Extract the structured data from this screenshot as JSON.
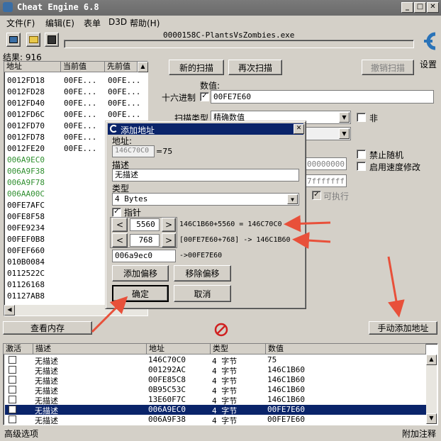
{
  "window": {
    "title": "Cheat Engine 6.8",
    "process": "0000158C-PlantsVsZombies.exe"
  },
  "menu": [
    "文件(F)",
    "编辑(E)",
    "表单",
    "D3D",
    "帮助(H)"
  ],
  "results": {
    "label": "结果: 916"
  },
  "list": {
    "headers": [
      "地址",
      "当前值",
      "先前值"
    ],
    "rows": [
      {
        "addr": "0012FD18",
        "cur": "00FE...",
        "prev": "00FE..."
      },
      {
        "addr": "0012FD28",
        "cur": "00FE...",
        "prev": "00FE..."
      },
      {
        "addr": "0012FD40",
        "cur": "00FE...",
        "prev": "00FE..."
      },
      {
        "addr": "0012FD6C",
        "cur": "00FE...",
        "prev": "00FE..."
      },
      {
        "addr": "0012FD70",
        "cur": "00FE...",
        "prev": "00FE..."
      },
      {
        "addr": "0012FD78",
        "cur": "00FE...",
        "prev": "00FE..."
      },
      {
        "addr": "0012FE20",
        "cur": "00FE...",
        "prev": "00FE..."
      },
      {
        "addr": "006A9EC0",
        "cur": "",
        "prev": "",
        "green": true
      },
      {
        "addr": "006A9F38",
        "cur": "",
        "prev": "",
        "green": true
      },
      {
        "addr": "006A9F78",
        "cur": "",
        "prev": "",
        "green": true
      },
      {
        "addr": "006AA00C",
        "cur": "",
        "prev": "",
        "green": true
      },
      {
        "addr": "00FE7AFC",
        "cur": "",
        "prev": ""
      },
      {
        "addr": "00FE8F58",
        "cur": "",
        "prev": ""
      },
      {
        "addr": "00FE9234",
        "cur": "",
        "prev": ""
      },
      {
        "addr": "00FEF0B8",
        "cur": "",
        "prev": ""
      },
      {
        "addr": "00FEF660",
        "cur": "",
        "prev": ""
      },
      {
        "addr": "010B0084",
        "cur": "",
        "prev": ""
      },
      {
        "addr": "0112522C",
        "cur": "",
        "prev": ""
      },
      {
        "addr": "01126168",
        "cur": "",
        "prev": ""
      },
      {
        "addr": "01127AB8",
        "cur": "",
        "prev": ""
      }
    ]
  },
  "scan": {
    "new_scan": "新的扫描",
    "next_scan": "再次扫描",
    "undo_scan": "撤销扫描",
    "settings": "设置",
    "value_label": "数值:",
    "hex_label": "十六进制",
    "value": "00FE7E60",
    "scan_type_label": "扫描类型",
    "scan_type": "精确数值",
    "not_label": "非",
    "no_random": "禁止随机",
    "speedhack": "启用速度修改",
    "hex_from": "00000000",
    "hex_to": "7fffffff",
    "executable": "可执行"
  },
  "memory_view": "查看内存",
  "manual_add": "手动添加地址",
  "dialog": {
    "title": "添加地址",
    "address_label": "地址:",
    "address": "146C70C0",
    "address_value": "=75",
    "desc_label": "描述",
    "desc": "无描述",
    "type_label": "类型",
    "type": "4 Bytes",
    "pointer_label": "指针",
    "offset1": "5560",
    "offset1_calc": "146C1B60+5560 = 146C70C0",
    "offset2": "768",
    "offset2_calc": "[00FE7E60+768] -> 146C1B60",
    "base": "006a9ec0",
    "base_calc": "->00FE7E60",
    "add_offset": "添加偏移",
    "remove_offset": "移除偏移",
    "ok": "确定",
    "cancel": "取消"
  },
  "table": {
    "headers": [
      "激活",
      "描述",
      "地址",
      "类型",
      "数值"
    ],
    "rows": [
      {
        "desc": "无描述",
        "addr": "146C70C0",
        "type": "4 字节",
        "value": "75"
      },
      {
        "desc": "无描述",
        "addr": "001292AC",
        "type": "4 字节",
        "value": "146C1B60"
      },
      {
        "desc": "无描述",
        "addr": "00FE85C8",
        "type": "4 字节",
        "value": "146C1B60"
      },
      {
        "desc": "无描述",
        "addr": "0B95C53C",
        "type": "4 字节",
        "value": "146C1B60"
      },
      {
        "desc": "无描述",
        "addr": "13E60F7C",
        "type": "4 字节",
        "value": "146C1B60"
      },
      {
        "desc": "无描述",
        "addr": "006A9EC0",
        "type": "4 字节",
        "value": "00FE7E60",
        "selected": true
      },
      {
        "desc": "无描述",
        "addr": "006A9F38",
        "type": "4 字节",
        "value": "00FE7E60"
      }
    ]
  },
  "status": {
    "left": "高级选项",
    "right": "附加注释"
  },
  "colors": {
    "accent": "#0a246a",
    "arrow": "#e8503a",
    "green_addr": "#2f8f2f"
  }
}
